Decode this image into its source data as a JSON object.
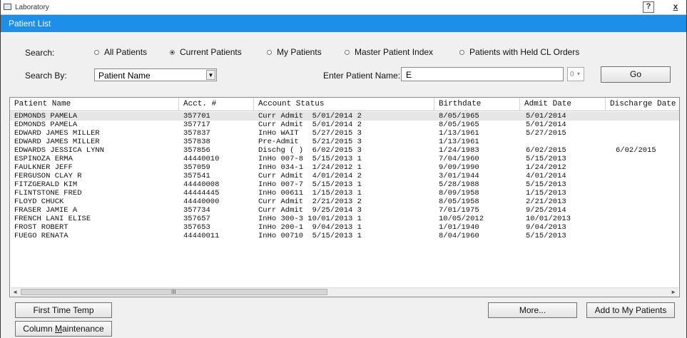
{
  "window": {
    "title": "Laboratory",
    "help_label": "?",
    "close_label": "x"
  },
  "header": {
    "title": "Patient List"
  },
  "search": {
    "label": "Search:",
    "options": [
      {
        "label": "All Patients",
        "checked": false
      },
      {
        "label": "Current Patients",
        "checked": true
      },
      {
        "label": "My Patients",
        "checked": false
      },
      {
        "label": "Master Patient Index",
        "checked": false
      },
      {
        "label": "Patients with Held CL Orders",
        "checked": false
      }
    ],
    "by_label": "Search By:",
    "by_value": "Patient Name",
    "name_label": "Enter Patient Name:",
    "name_value": "E",
    "spin_value": "0",
    "go_label": "Go"
  },
  "table": {
    "columns": [
      "Patient Name",
      "Acct. #",
      "Account Status",
      "Birthdate",
      "Admit Date",
      "Discharge Date"
    ],
    "rows": [
      [
        "EDMONDS PAMELA",
        "357701",
        "Curr Admit  5/01/2014 2",
        "8/05/1965",
        "5/01/2014",
        ""
      ],
      [
        "EDMONDS PAMELA",
        "357717",
        "Curr Admit  5/01/2014 2",
        "8/05/1965",
        "5/01/2014",
        ""
      ],
      [
        "EDWARD JAMES MILLER",
        "357837",
        "InHo WAIT   5/27/2015 3",
        "1/13/1961",
        "5/27/2015",
        ""
      ],
      [
        "EDWARD JAMES MILLER",
        "357838",
        "Pre-Admit   5/21/2015 3",
        "1/13/1961",
        "",
        ""
      ],
      [
        "EDWARDS JESSICA LYNN",
        "357856",
        "Dischg ( )  6/02/2015 3",
        "1/24/1983",
        "6/02/2015",
        "6/02/2015"
      ],
      [
        "ESPINOZA ERMA",
        "44440010",
        "InHo 007-8  5/15/2013 1",
        "7/04/1960",
        "5/15/2013",
        ""
      ],
      [
        "FAULKNER JEFF",
        "357059",
        "InHo 034-1  1/24/2012 1",
        "9/09/1990",
        "1/24/2012",
        ""
      ],
      [
        "FERGUSON CLAY R",
        "357541",
        "Curr Admit  4/01/2014 2",
        "3/01/1944",
        "4/01/2014",
        ""
      ],
      [
        "FITZGERALD KIM",
        "44440008",
        "InHo 007-7  5/15/2013 1",
        "5/28/1988",
        "5/15/2013",
        ""
      ],
      [
        "FLINTSTONE FRED",
        "44444445",
        "InHo 00611  1/15/2013 1",
        "8/09/1958",
        "1/15/2013",
        ""
      ],
      [
        "FLOYD CHUCK",
        "44440000",
        "Curr Admit  2/21/2013 2",
        "8/05/1958",
        "2/21/2013",
        ""
      ],
      [
        "FRASER JAMIE A",
        "357734",
        "Curr Admit  9/25/2014 3",
        "7/01/1975",
        "9/25/2014",
        ""
      ],
      [
        "FRENCH LANI ELISE",
        "357657",
        "InHo 300-3 10/01/2013 1",
        "10/05/2012",
        "10/01/2013",
        ""
      ],
      [
        "FROST ROBERT",
        "357653",
        "InHo 200-1  9/04/2013 1",
        "1/01/1940",
        "9/04/2013",
        ""
      ],
      [
        "FUEGO RENATA",
        "44440011",
        "InHo 00710  5/15/2013 1",
        "8/04/1960",
        "5/15/2013",
        ""
      ]
    ],
    "selected_row": 0,
    "scroll_grip": "III"
  },
  "buttons": {
    "first_time_temp": "First Time Temp",
    "column_maintenance_prefix": "Column ",
    "column_maintenance_accel": "M",
    "column_maintenance_suffix": "aintenance",
    "more": "More...",
    "add_to_my_patients": "Add to My Patients"
  }
}
